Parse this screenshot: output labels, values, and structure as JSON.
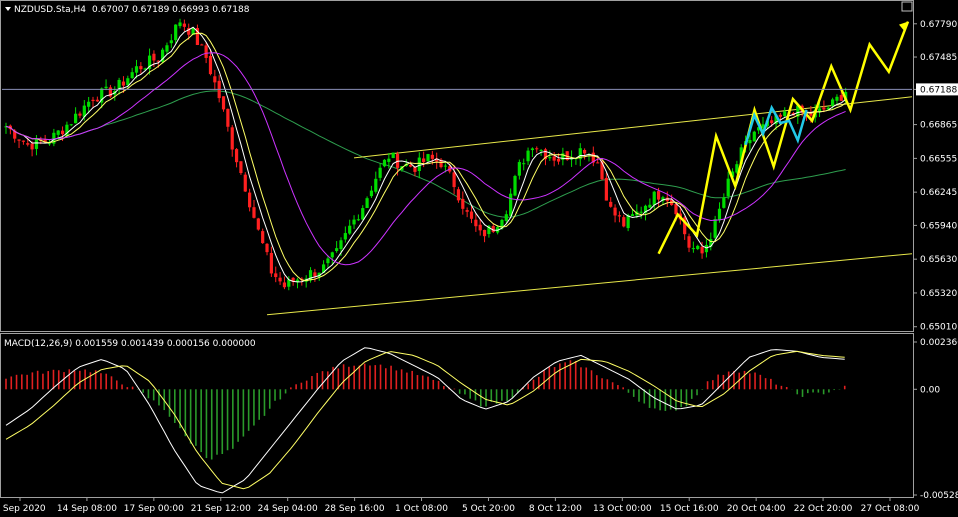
{
  "header": {
    "symbol": "NZDUSD.Sta,H4",
    "ohlc": "0.67007 0.67189 0.66993 0.67188"
  },
  "macd_header": {
    "label": "MACD(12,26,9) 0.001559 0.001439 0.000156 0.000000"
  },
  "colors": {
    "background": "#000000",
    "bull_candle": "#00dd00",
    "bear_candle": "#ff2020",
    "fast_ma": "#ffffff",
    "mid_ma": "#ffff66",
    "slow_ma": "#cc33ff",
    "long_ma": "#2e9e4e",
    "channel": "#e8e84a",
    "forecast_yellow": "#ffff00",
    "forecast_cyan": "#22c8e8",
    "macd_pos": "#e02020",
    "macd_neg": "#2a9a2a",
    "price_line": "#8a8fb8"
  },
  "chart_data": [
    {
      "type": "candlestick",
      "title": "NZDUSD.Sta,H4",
      "current_price": "0.67188",
      "y_ticks": [
        "0.67790",
        "0.67485",
        "0.67188",
        "0.66865",
        "0.66555",
        "0.66245",
        "0.65940",
        "0.65630",
        "0.65320",
        "0.65010"
      ],
      "ylim": [
        0.6498,
        0.6799
      ],
      "x_ticks": [
        "9 Sep 2020",
        "14 Sep 08:00",
        "17 Sep 00:00",
        "21 Sep 12:00",
        "24 Sep 04:00",
        "28 Sep 16:00",
        "1 Oct 08:00",
        "5 Oct 20:00",
        "8 Oct 12:00",
        "13 Oct 00:00",
        "15 Oct 16:00",
        "20 Oct 04:00",
        "22 Oct 20:00",
        "27 Oct 08:00"
      ],
      "close_path": [
        [
          0,
          0.6685
        ],
        [
          5,
          0.6668
        ],
        [
          10,
          0.6672
        ],
        [
          15,
          0.669
        ],
        [
          20,
          0.6712
        ],
        [
          25,
          0.6718
        ],
        [
          30,
          0.6738
        ],
        [
          35,
          0.6748
        ],
        [
          38,
          0.6768
        ],
        [
          40,
          0.6782
        ],
        [
          43,
          0.677
        ],
        [
          46,
          0.6748
        ],
        [
          49,
          0.6712
        ],
        [
          52,
          0.6668
        ],
        [
          55,
          0.663
        ],
        [
          58,
          0.6588
        ],
        [
          61,
          0.6552
        ],
        [
          64,
          0.6538
        ],
        [
          67,
          0.6545
        ],
        [
          70,
          0.655
        ],
        [
          73,
          0.6555
        ],
        [
          76,
          0.6568
        ],
        [
          79,
          0.6592
        ],
        [
          82,
          0.6612
        ],
        [
          85,
          0.6638
        ],
        [
          88,
          0.6658
        ],
        [
          91,
          0.665
        ],
        [
          94,
          0.6648
        ],
        [
          97,
          0.6655
        ],
        [
          100,
          0.6652
        ],
        [
          103,
          0.6632
        ],
        [
          106,
          0.6604
        ],
        [
          109,
          0.6585
        ],
        [
          112,
          0.6592
        ],
        [
          115,
          0.661
        ],
        [
          118,
          0.6648
        ],
        [
          121,
          0.667
        ],
        [
          124,
          0.666
        ],
        [
          127,
          0.6655
        ],
        [
          130,
          0.666
        ],
        [
          133,
          0.6665
        ],
        [
          136,
          0.6652
        ],
        [
          139,
          0.6608
        ],
        [
          142,
          0.6595
        ],
        [
          145,
          0.6605
        ],
        [
          148,
          0.6618
        ],
        [
          151,
          0.6625
        ],
        [
          154,
          0.661
        ],
        [
          157,
          0.6575
        ],
        [
          160,
          0.6568
        ],
        [
          163,
          0.6595
        ],
        [
          166,
          0.6632
        ],
        [
          169,
          0.666
        ],
        [
          172,
          0.668
        ],
        [
          175,
          0.6685
        ],
        [
          178,
          0.6692
        ],
        [
          181,
          0.67
        ],
        [
          184,
          0.6695
        ],
        [
          187,
          0.6698
        ],
        [
          190,
          0.6705
        ],
        [
          193,
          0.6718
        ]
      ],
      "channel_upper": [
        [
          0.6655,
          1
        ],
        [
          0.671,
          1
        ]
      ],
      "channel_lower": [
        [
          0.6512,
          1
        ],
        [
          0.6568,
          1
        ]
      ],
      "forecast_yellow": [
        0.6568,
        0.6604,
        0.6585,
        0.6676,
        0.663,
        0.67,
        0.6648,
        0.671,
        0.669,
        0.674,
        0.67,
        0.676,
        0.6735,
        0.6781
      ],
      "forecast_cyan": [
        0.6668,
        0.6695,
        0.6678,
        0.6702,
        0.6688,
        0.669,
        0.6672,
        0.67
      ]
    },
    {
      "type": "macd",
      "title": "MACD(12,26,9)",
      "y_ticks": [
        "0.002366",
        "0.00",
        "-0.005288"
      ],
      "ylim": [
        -0.005288,
        0.002366
      ],
      "histogram": [
        0.0006,
        0.0008,
        0.0009,
        0.001,
        0.0009,
        0.0004,
        -0.0002,
        -0.001,
        -0.0025,
        -0.0035,
        -0.003,
        -0.0018,
        -0.0005,
        0.0004,
        0.0009,
        0.0012,
        0.0013,
        0.0011,
        0.0008,
        0.0004,
        -0.0002,
        -0.0008,
        -0.0006,
        0.0002,
        0.0011,
        0.0014,
        0.0008,
        0.0002,
        -0.0006,
        -0.0012,
        -0.0008,
        0.0004,
        0.001,
        0.0008,
        0.0003,
        -0.0003,
        -0.0002,
        0.0001
      ],
      "macd_line": [
        -0.0018,
        -0.001,
        0.0001,
        0.0011,
        0.0015,
        0.001,
        -0.0008,
        -0.003,
        -0.0048,
        -0.0052,
        -0.0045,
        -0.003,
        -0.0015,
        0.0,
        0.0014,
        0.0021,
        0.0018,
        0.0012,
        0.0006,
        -0.0005,
        -0.001,
        -0.0006,
        0.0006,
        0.0014,
        0.0017,
        0.0011,
        0.0005,
        -0.0004,
        -0.001,
        -0.0008,
        0.0004,
        0.0016,
        0.002,
        0.0019,
        0.0016,
        0.0015
      ],
      "signal_line": [
        -0.0025,
        -0.0018,
        -0.0008,
        0.0003,
        0.001,
        0.0012,
        0.0004,
        -0.0012,
        -0.0032,
        -0.0047,
        -0.005,
        -0.0042,
        -0.0028,
        -0.0012,
        0.0003,
        0.0014,
        0.0019,
        0.0017,
        0.0012,
        0.0003,
        -0.0005,
        -0.0008,
        -0.0001,
        0.0009,
        0.0015,
        0.0014,
        0.0009,
        0.0002,
        -0.0006,
        -0.0009,
        -0.0002,
        0.0009,
        0.0017,
        0.0019,
        0.0017,
        0.0016
      ]
    }
  ]
}
